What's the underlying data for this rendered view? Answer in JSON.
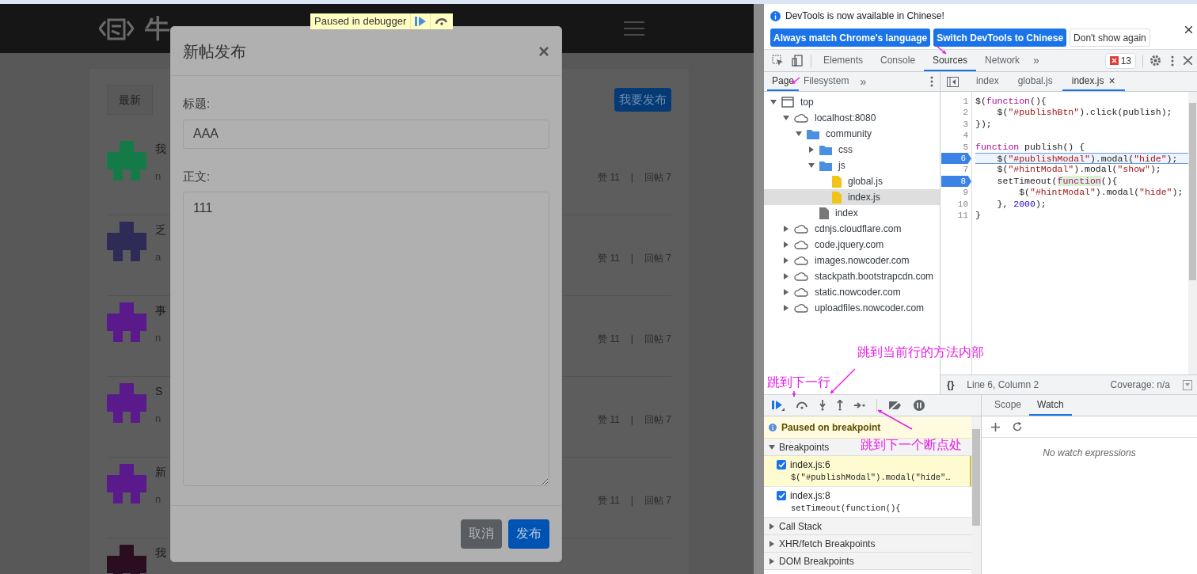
{
  "page": {
    "logo_text": "牛",
    "paused_overlay": {
      "text": "Paused in debugger"
    },
    "tabs": [
      {
        "label": "最新",
        "selected": true
      }
    ],
    "publish_button": "我要发布",
    "posts": [
      {
        "title": "我",
        "meta": "n",
        "likes": "赞 11",
        "sep": "|",
        "replies": "回帖 7",
        "color": "#147a48"
      },
      {
        "title": "乏",
        "meta": "a",
        "likes": "赞 11",
        "sep": "|",
        "replies": "回帖 7",
        "color": "#2e2c57"
      },
      {
        "title": "事",
        "meta": "n",
        "likes": "赞 11",
        "sep": "|",
        "replies": "回帖 7",
        "color": "#5a1a8c"
      },
      {
        "title": "S",
        "meta": "n",
        "likes": "赞 11",
        "sep": "|",
        "replies": "回帖 7",
        "color": "#5a1a8c"
      },
      {
        "title": "新",
        "meta": "n",
        "likes": "赞 11",
        "sep": "|",
        "replies": "回帖 7",
        "color": "#5a1a8c"
      },
      {
        "title": "我",
        "color": "#2a0e20"
      }
    ],
    "modal": {
      "title": "新帖发布",
      "close": "×",
      "title_label": "标题:",
      "title_value": "AAA",
      "body_label": "正文:",
      "body_value": "111",
      "buttons": [
        {
          "label": "取消",
          "kind": "secondary"
        },
        {
          "label": "发布",
          "kind": "primary"
        }
      ]
    }
  },
  "devtools": {
    "infobar": {
      "message": "DevTools is now available in Chinese!",
      "buttons": [
        {
          "label": "Always match Chrome's language",
          "kind": "primary"
        },
        {
          "label": "Switch DevTools to Chinese",
          "kind": "primary"
        },
        {
          "label": "Don't show again",
          "kind": "secondary"
        }
      ]
    },
    "tabs": [
      {
        "label": "Elements",
        "selected": false
      },
      {
        "label": "Console",
        "selected": false
      },
      {
        "label": "Sources",
        "selected": true
      },
      {
        "label": "Network",
        "selected": false
      }
    ],
    "more_tabs": "»",
    "error_count": "13",
    "navigator_tabs": [
      {
        "label": "Page",
        "selected": true
      },
      {
        "label": "Filesystem",
        "selected": false
      }
    ],
    "tree": [
      {
        "label": "top",
        "kind": "frame",
        "expanded": true,
        "selected": false,
        "children": [
          {
            "label": "localhost:8080",
            "kind": "domain",
            "expanded": true,
            "selected": false,
            "children": [
              {
                "label": "community",
                "kind": "folder",
                "expanded": true,
                "selected": false,
                "children": [
                  {
                    "label": "css",
                    "kind": "folder",
                    "expanded": false,
                    "selected": false
                  },
                  {
                    "label": "js",
                    "kind": "folder",
                    "expanded": true,
                    "selected": false,
                    "children": [
                      {
                        "label": "global.js",
                        "kind": "script",
                        "selected": false
                      },
                      {
                        "label": "index.js",
                        "kind": "script",
                        "selected": true
                      }
                    ]
                  },
                  {
                    "label": "index",
                    "kind": "document",
                    "selected": false
                  }
                ]
              }
            ]
          },
          {
            "label": "cdnjs.cloudflare.com",
            "kind": "domain",
            "expanded": false,
            "selected": false
          },
          {
            "label": "code.jquery.com",
            "kind": "domain",
            "expanded": false,
            "selected": false
          },
          {
            "label": "images.nowcoder.com",
            "kind": "domain",
            "expanded": false,
            "selected": false
          },
          {
            "label": "stackpath.bootstrapcdn.com",
            "kind": "domain",
            "expanded": false,
            "selected": false
          },
          {
            "label": "static.nowcoder.com",
            "kind": "domain",
            "expanded": false,
            "selected": false
          },
          {
            "label": "uploadfiles.nowcoder.com",
            "kind": "domain",
            "expanded": false,
            "selected": false
          }
        ]
      }
    ],
    "file_tabs": [
      {
        "label": "index",
        "selected": false
      },
      {
        "label": "global.js",
        "selected": false
      },
      {
        "label": "index.js",
        "selected": true,
        "close": "×"
      }
    ],
    "code": [
      {
        "number": "1",
        "breakpoint": false,
        "current": false,
        "tokens": [
          {
            "t": "$(",
            "kind": "plain"
          },
          {
            "t": "function",
            "kind": "keyword"
          },
          {
            "t": "(){",
            "kind": "plain"
          }
        ]
      },
      {
        "number": "2",
        "breakpoint": false,
        "current": false,
        "tokens": [
          {
            "t": "    $(",
            "kind": "plain"
          },
          {
            "t": "\"#publishBtn\"",
            "kind": "string"
          },
          {
            "t": ").click(publish);",
            "kind": "plain"
          }
        ]
      },
      {
        "number": "3",
        "breakpoint": false,
        "current": false,
        "tokens": [
          {
            "t": "});",
            "kind": "plain"
          }
        ]
      },
      {
        "number": "4",
        "breakpoint": false,
        "current": false
      },
      {
        "number": "5",
        "breakpoint": false,
        "current": false,
        "tokens": [
          {
            "t": "function",
            "kind": "keyword"
          },
          {
            "t": " publish() {",
            "kind": "plain"
          }
        ]
      },
      {
        "number": "6",
        "breakpoint": true,
        "current": true,
        "tokens": [
          {
            "t": "    $(",
            "kind": "plain"
          },
          {
            "t": "\"#publishModal\"",
            "kind": "string"
          },
          {
            "t": ").modal(",
            "kind": "plain"
          },
          {
            "t": "\"hide\"",
            "kind": "string"
          },
          {
            "t": ");",
            "kind": "plain"
          }
        ]
      },
      {
        "number": "7",
        "breakpoint": false,
        "current": false,
        "tokens": [
          {
            "t": "    $(",
            "kind": "plain"
          },
          {
            "t": "\"#hintModal\"",
            "kind": "string"
          },
          {
            "t": ").modal(",
            "kind": "plain"
          },
          {
            "t": "\"show\"",
            "kind": "string"
          },
          {
            "t": ");",
            "kind": "plain"
          }
        ]
      },
      {
        "number": "8",
        "breakpoint": true,
        "current": false,
        "tokens": [
          {
            "t": "    setTimeout(",
            "kind": "plain"
          },
          {
            "t": "function",
            "kind": "keyword_match"
          },
          {
            "t": "(){",
            "kind": "plain"
          }
        ]
      },
      {
        "number": "9",
        "breakpoint": false,
        "current": false,
        "tokens": [
          {
            "t": "        $(",
            "kind": "plain"
          },
          {
            "t": "\"#hintModal\"",
            "kind": "string"
          },
          {
            "t": ").modal(",
            "kind": "plain"
          },
          {
            "t": "\"hide\"",
            "kind": "string"
          },
          {
            "t": ");",
            "kind": "plain"
          }
        ]
      },
      {
        "number": "10",
        "breakpoint": false,
        "current": false,
        "tokens": [
          {
            "t": "    }, ",
            "kind": "plain"
          },
          {
            "t": "2000",
            "kind": "number"
          },
          {
            "t": ");",
            "kind": "plain"
          }
        ]
      },
      {
        "number": "11",
        "breakpoint": false,
        "current": false,
        "tokens": [
          {
            "t": "}",
            "kind": "plain"
          }
        ]
      }
    ],
    "status": {
      "format": "{}",
      "position": "Line 6, Column 2",
      "coverage": "Coverage: n/a"
    },
    "paused_message": "Paused on breakpoint",
    "sections": [
      {
        "title": "Breakpoints",
        "expanded": true
      },
      {
        "title": "Call Stack",
        "expanded": false
      },
      {
        "title": "XHR/fetch Breakpoints",
        "expanded": false
      },
      {
        "title": "DOM Breakpoints",
        "expanded": false
      }
    ],
    "breakpoints": [
      {
        "location": "index.js:6",
        "code": "$(\"#publishModal\").modal(\"hide\"…",
        "checked": true,
        "active": true
      },
      {
        "location": "index.js:8",
        "code": "setTimeout(function(){",
        "checked": true,
        "active": false
      }
    ],
    "side_tabs": [
      {
        "label": "Scope",
        "selected": false
      },
      {
        "label": "Watch",
        "selected": true
      }
    ],
    "watch_empty": "No watch expressions"
  },
  "annotations": [
    {
      "text": "跳到当前行的方法内部"
    },
    {
      "text": "跳到下一行"
    },
    {
      "text": "跳到下一个断点处"
    }
  ]
}
